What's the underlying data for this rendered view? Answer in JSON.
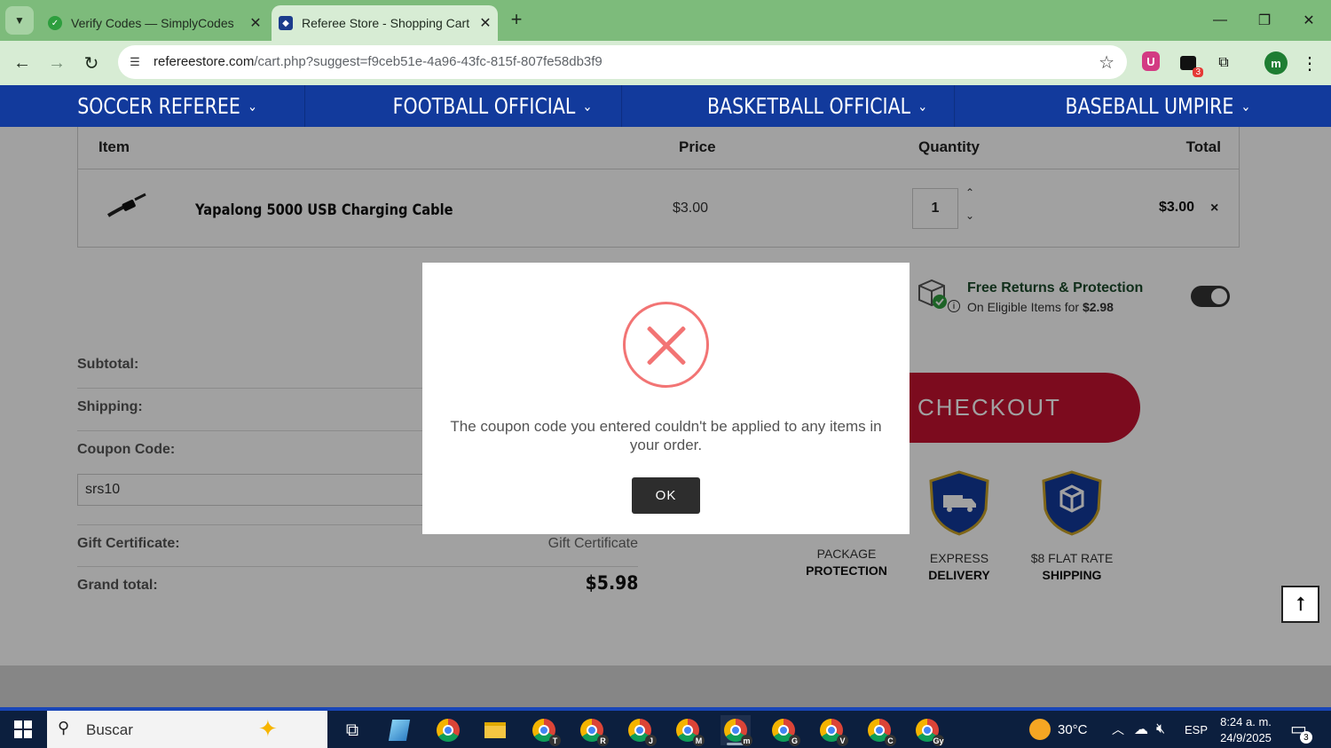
{
  "browser": {
    "tabs": [
      {
        "title": "Verify Codes — SimplyCodes",
        "active": false
      },
      {
        "title": "Referee Store - Shopping Cart",
        "active": true
      }
    ],
    "url_host": "refereestore.com",
    "url_path": "/cart.php?suggest=f9ceb51e-4a96-43fc-815f-807fe58db3f9",
    "extension_badge": "3",
    "profile_initial": "m"
  },
  "nav": {
    "categories": [
      "SOCCER REFEREE",
      "FOOTBALL OFFICIAL",
      "BASKETBALL OFFICIAL",
      "BASEBALL UMPIRE"
    ]
  },
  "cart": {
    "headers": {
      "item": "Item",
      "price": "Price",
      "quantity": "Quantity",
      "total": "Total"
    },
    "items": [
      {
        "name": "Yapalong 5000 USB Charging Cable",
        "price": "$3.00",
        "quantity": "1",
        "total": "$3.00"
      }
    ]
  },
  "protection": {
    "title": "Free Returns & Protection",
    "subtitle_prefix": "On Eligible Items for ",
    "price": "$2.98",
    "enabled": true
  },
  "summary": {
    "subtotal_label": "Subtotal:",
    "shipping_label": "Shipping:",
    "coupon_label": "Coupon Code:",
    "coupon_value": "srs10",
    "gift_label": "Gift Certificate:",
    "gift_placeholder": "Gift Certificate",
    "grand_label": "Grand total:",
    "grand_value": "$5.98"
  },
  "checkout_label": "CHECKOUT",
  "features": [
    {
      "line1": "PACKAGE",
      "line2": "PROTECTION"
    },
    {
      "line1": "EXPRESS",
      "line2": "DELIVERY"
    },
    {
      "line1": "$8 FLAT RATE",
      "line2": "SHIPPING"
    }
  ],
  "modal": {
    "message": "The coupon code you entered couldn't be applied to any items in your order.",
    "ok_label": "OK"
  },
  "taskbar": {
    "search_placeholder": "Buscar",
    "weather": "30°C",
    "language": "ESP",
    "time": "8:24 a. m.",
    "date": "24/9/2025",
    "notifications": "3",
    "chrome_profiles": [
      "T",
      "R",
      "J",
      "M",
      "m",
      "G",
      "V",
      "C",
      "Gy"
    ]
  },
  "colors": {
    "tabbar": "#7dbb7b",
    "nav": "#123a9c",
    "checkout": "#c41230",
    "error": "#f27474"
  }
}
